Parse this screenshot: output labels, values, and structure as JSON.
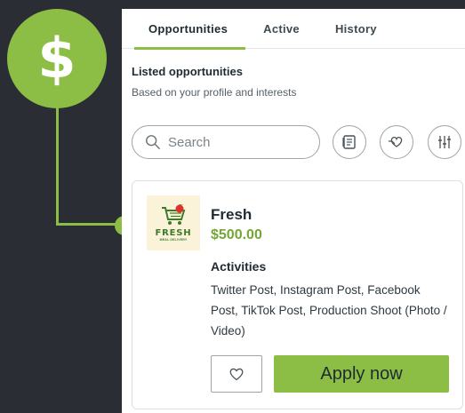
{
  "callout": {
    "icon": "dollar-icon",
    "symbol": "$"
  },
  "tabs": [
    {
      "label": "Opportunities",
      "active": true
    },
    {
      "label": "Active",
      "active": false
    },
    {
      "label": "History",
      "active": false
    }
  ],
  "section": {
    "title": "Listed opportunities",
    "subtitle": "Based on your profile and interests"
  },
  "search": {
    "placeholder": "Search",
    "value": ""
  },
  "filters": [
    {
      "icon": "list-icon"
    },
    {
      "icon": "heart-hand-icon"
    },
    {
      "icon": "sliders-icon"
    }
  ],
  "opportunity": {
    "logo": {
      "text": "FRESH",
      "subtext": "MEAL DELIVERY",
      "icon": "shopping-cart-icon"
    },
    "name": "Fresh",
    "price": "$500.00",
    "activities_title": "Activities",
    "activities": "Twitter Post,  Instagram Post,  Facebook Post,  TikTok Post,  Production Shoot (Photo / Video)",
    "favorite_icon": "heart-icon",
    "apply_label": "Apply now"
  },
  "colors": {
    "accent": "#8cbd45",
    "price": "#73a634",
    "background": "#2a2e34",
    "text": "#1f2b33"
  }
}
